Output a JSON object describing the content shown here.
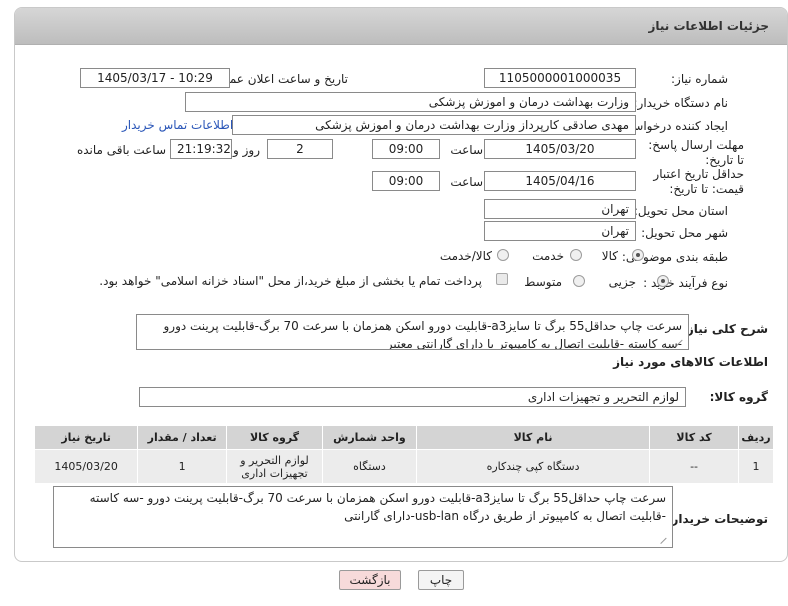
{
  "header": {
    "title": "جزئیات اطلاعات نیاز"
  },
  "fields": {
    "need_number_label": "شماره نیاز:",
    "need_number": "1105000001000035",
    "announce_label": "تاریخ و ساعت اعلان عمومی:",
    "announce_value": "1405/03/17 - 10:29",
    "buyer_org_label": "نام دستگاه خریدار:",
    "buyer_org": "وزارت بهداشت  درمان و اموزش پزشکی",
    "creator_label": "ایجاد کننده درخواست:",
    "creator": "مهدی صادقی کارپرداز وزارت بهداشت  درمان و اموزش پزشکی",
    "contact_link": "اطلاعات تماس خریدار",
    "deadline_label": "مهلت ارسال پاسخ: تا تاریخ:",
    "deadline_date": "1405/03/20",
    "time_label": "ساعت",
    "deadline_time": "09:00",
    "days_value": "2",
    "days_label": "روز و",
    "remaining_time": "21:19:32",
    "remaining_label": "ساعت باقی مانده",
    "price_validity_label": "حداقل تاریخ اعتبار قیمت: تا تاریخ:",
    "price_validity_date": "1405/04/16",
    "price_validity_time": "09:00",
    "province_label": "استان محل تحویل:",
    "province": "تهران",
    "city_label": "شهر محل تحویل:",
    "city": "تهران",
    "category_label": "طبقه بندی موضوعی:",
    "category_options": [
      "کالا",
      "خدمت",
      "کالا/خدمت"
    ],
    "process_label": "نوع فرآیند خرید :",
    "process_options": [
      "جزیی",
      "متوسط"
    ],
    "treasury_note": "پرداخت تمام یا بخشی از مبلغ خرید،از محل \"اسناد خزانه اسلامی\" خواهد بود."
  },
  "description": {
    "label": "شرح کلی نیاز:",
    "text": "سرعت چاپ حداقل55 برگ تا سایزa3-قابلیت دورو اسکن همزمان با سرعت 70 برگ-قابلیت پرینت دورو -سه کاسته -قابلیت اتصال به کامپیوتر با دارای گارانتی معتبر"
  },
  "goods_section": {
    "title": "اطلاعات کالاهای مورد نیاز",
    "group_label": "گروه کالا:",
    "group_value": "لوازم التحریر و تجهیزات اداری"
  },
  "table": {
    "headers": [
      "ردیف",
      "کد کالا",
      "نام کالا",
      "واحد شمارش",
      "گروه کالا",
      "تعداد / مقدار",
      "تاریخ نیاز"
    ],
    "rows": [
      [
        "1",
        "--",
        "دستگاه کپی چندکاره",
        "دستگاه",
        "لوازم التحریر و تجهیزات اداری",
        "1",
        "1405/03/20"
      ]
    ]
  },
  "buyer_notes": {
    "label": "توضیحات خریدار:",
    "text": "سرعت چاپ حداقل55 برگ تا سایزa3-قابلیت دورو اسکن همزمان با سرعت 70 برگ-قابلیت پرینت دورو -سه کاسته -قابلیت اتصال به کامپیوتر از طریق درگاه usb-lan-دارای گارانتی"
  },
  "buttons": {
    "print": "چاپ",
    "back": "بازگشت"
  },
  "colors": {
    "link": "#2a56b8",
    "back_button": "#f7dada",
    "print_button": "#f4f4f4"
  }
}
